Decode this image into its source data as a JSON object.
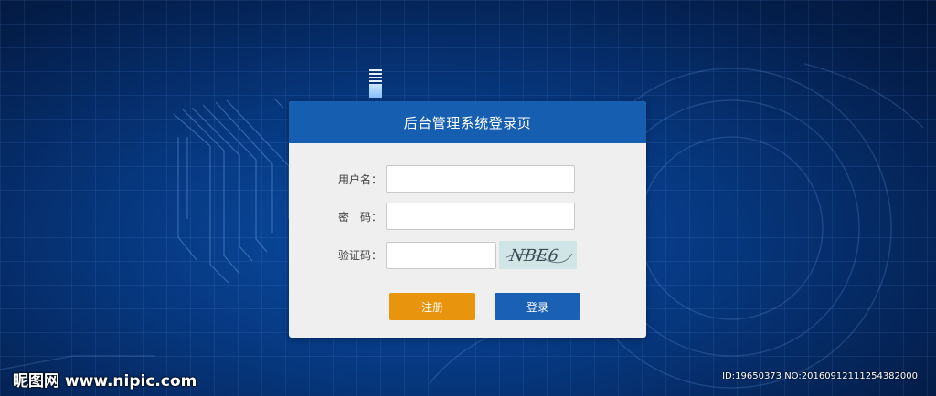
{
  "login": {
    "title": "后台管理系统登录页",
    "username_label": "用户名：",
    "password_label": "密　码：",
    "captcha_label": "验证码：",
    "username_value": "",
    "password_value": "",
    "captcha_value": "",
    "captcha_text": "NBE6",
    "register_label": "注册",
    "login_label": "登录"
  },
  "watermark": {
    "site": "昵图网 www.nipic.com",
    "id_text": "ID:19650373 NO:20160912111254382000"
  },
  "colors": {
    "header": "#165fb0",
    "register_button": "#e8940d",
    "login_button": "#1a60b4",
    "background": "#06357a"
  }
}
